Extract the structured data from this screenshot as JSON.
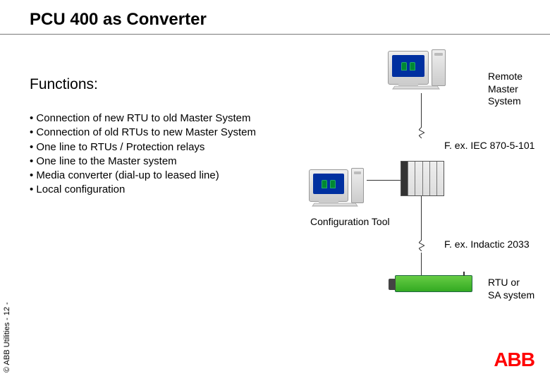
{
  "title": "PCU 400 as Converter",
  "functions_heading": "Functions:",
  "bullets": {
    "b1": "Connection of new RTU to old Master System",
    "b2": "Connection of old RTUs to new Master System",
    "b3": "One line to RTUs / Protection relays",
    "b4": "One line to the Master system",
    "b5": "Media converter (dial-up to leased line)",
    "b6": "Local configuration"
  },
  "labels": {
    "config_tool": "Configuration Tool",
    "remote_l1": "Remote",
    "remote_l2": "Master System",
    "protocol": "F. ex. IEC 870-5-101",
    "indactic": "F. ex. Indactic 2033",
    "rtu_l1": "RTU or",
    "rtu_l2": "SA system"
  },
  "footer": {
    "copyright": "© ABB Utilities  - 12 -",
    "logo_text": "ABB"
  }
}
